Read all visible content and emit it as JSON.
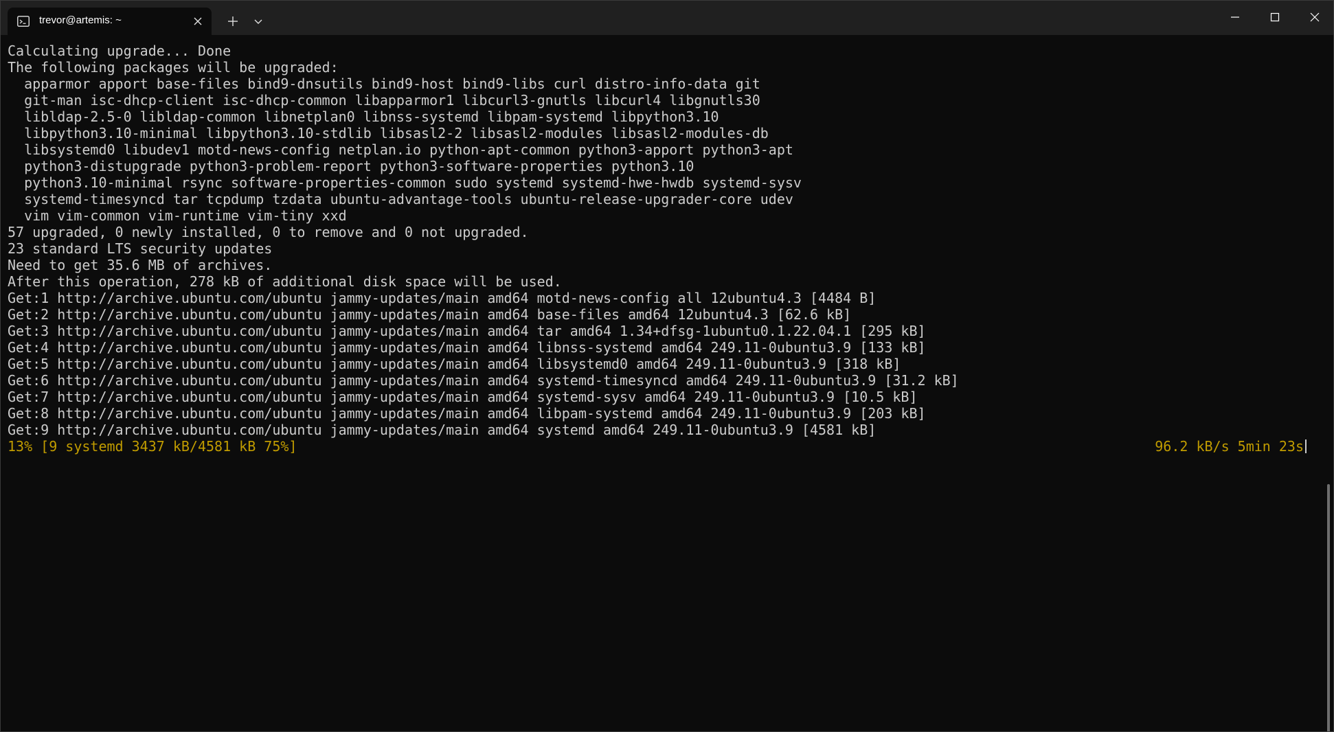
{
  "window": {
    "tab_title": "trevor@artemis: ~",
    "icons": {
      "tab": "terminal-icon",
      "tab_close": "close-icon",
      "new_tab": "plus-icon",
      "dropdown": "chevron-down-icon",
      "minimize": "minimize-icon",
      "maximize": "maximize-icon",
      "close": "close-icon"
    }
  },
  "terminal": {
    "colors": {
      "background": "#0c0c0c",
      "foreground": "#cccccc",
      "progress": "#c19c00"
    },
    "lines": [
      "Calculating upgrade... Done",
      "The following packages will be upgraded:",
      "  apparmor apport base-files bind9-dnsutils bind9-host bind9-libs curl distro-info-data git",
      "  git-man isc-dhcp-client isc-dhcp-common libapparmor1 libcurl3-gnutls libcurl4 libgnutls30",
      "  libldap-2.5-0 libldap-common libnetplan0 libnss-systemd libpam-systemd libpython3.10",
      "  libpython3.10-minimal libpython3.10-stdlib libsasl2-2 libsasl2-modules libsasl2-modules-db",
      "  libsystemd0 libudev1 motd-news-config netplan.io python-apt-common python3-apport python3-apt",
      "  python3-distupgrade python3-problem-report python3-software-properties python3.10",
      "  python3.10-minimal rsync software-properties-common sudo systemd systemd-hwe-hwdb systemd-sysv",
      "  systemd-timesyncd tar tcpdump tzdata ubuntu-advantage-tools ubuntu-release-upgrader-core udev",
      "  vim vim-common vim-runtime vim-tiny xxd",
      "57 upgraded, 0 newly installed, 0 to remove and 0 not upgraded.",
      "23 standard LTS security updates",
      "Need to get 35.6 MB of archives.",
      "After this operation, 278 kB of additional disk space will be used.",
      "Get:1 http://archive.ubuntu.com/ubuntu jammy-updates/main amd64 motd-news-config all 12ubuntu4.3 [4484 B]",
      "Get:2 http://archive.ubuntu.com/ubuntu jammy-updates/main amd64 base-files amd64 12ubuntu4.3 [62.6 kB]",
      "Get:3 http://archive.ubuntu.com/ubuntu jammy-updates/main amd64 tar amd64 1.34+dfsg-1ubuntu0.1.22.04.1 [295 kB]",
      "Get:4 http://archive.ubuntu.com/ubuntu jammy-updates/main amd64 libnss-systemd amd64 249.11-0ubuntu3.9 [133 kB]",
      "Get:5 http://archive.ubuntu.com/ubuntu jammy-updates/main amd64 libsystemd0 amd64 249.11-0ubuntu3.9 [318 kB]",
      "Get:6 http://archive.ubuntu.com/ubuntu jammy-updates/main amd64 systemd-timesyncd amd64 249.11-0ubuntu3.9 [31.2 kB]",
      "Get:7 http://archive.ubuntu.com/ubuntu jammy-updates/main amd64 systemd-sysv amd64 249.11-0ubuntu3.9 [10.5 kB]",
      "Get:8 http://archive.ubuntu.com/ubuntu jammy-updates/main amd64 libpam-systemd amd64 249.11-0ubuntu3.9 [203 kB]",
      "Get:9 http://archive.ubuntu.com/ubuntu jammy-updates/main amd64 systemd amd64 249.11-0ubuntu3.9 [4581 kB]"
    ],
    "progress_left": "13% [9 systemd 3437 kB/4581 kB 75%]",
    "progress_right": "96.2 kB/s 5min 23s"
  }
}
